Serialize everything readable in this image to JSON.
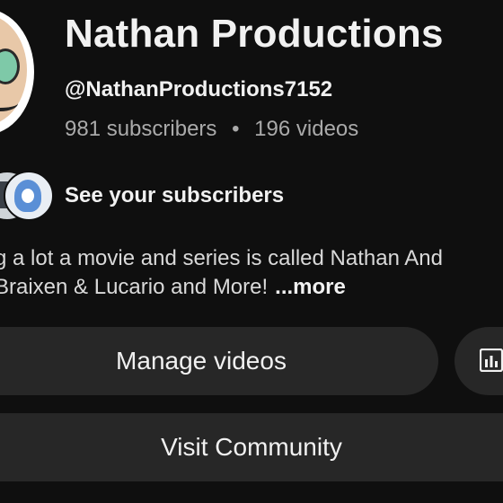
{
  "channel": {
    "name": "Nathan Productions",
    "handle": "@NathanProductions7152",
    "subscribers": "981 subscribers",
    "separator": "•",
    "videos": "196 videos"
  },
  "subscribers_row": {
    "label": "See your subscribers"
  },
  "description": {
    "line1": "g a lot a movie and series is called Nathan And",
    "line2": "Braixen & Lucario and More!",
    "more_label": "...more"
  },
  "buttons": {
    "manage_videos": "Manage videos",
    "analytics_icon": "analytics-bar-chart-icon",
    "visit_community": "Visit Community"
  },
  "colors": {
    "background": "#0f0f0f",
    "button_bg": "#272727",
    "text_primary": "#f1f1f1",
    "text_secondary": "#aaaaaa"
  }
}
